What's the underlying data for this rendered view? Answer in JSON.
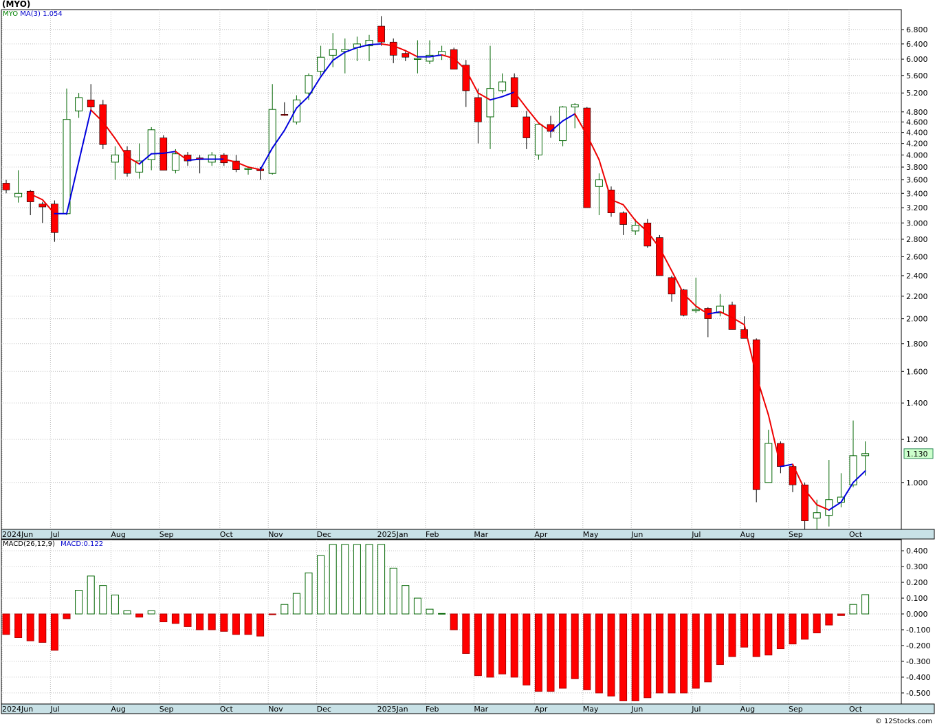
{
  "header": {
    "symbol_title": "(MYO)",
    "price_legend_symbol": "MYO",
    "price_legend_ma": "MA(3)",
    "price_legend_ma_value": "1.054",
    "macd_legend_name": "MACD(26,12,9)",
    "macd_legend_value": "MACD:0.122"
  },
  "footer": {
    "credit": "© 12Stocks.com"
  },
  "colors": {
    "up_candle": "#006400",
    "down_candle": "#ff0000",
    "ma_rising": "#0000dd",
    "ma_falling": "#ee0000",
    "macd_up": "#006400",
    "macd_down": "#ff0000",
    "last_price_box": "#ccffcc"
  },
  "chart_data": [
    {
      "type": "candlestick",
      "title": "(MYO)",
      "interval": "weekly",
      "yscale": "log",
      "ylim": [
        0.82,
        7.4
      ],
      "yticks": [
        1.0,
        1.2,
        1.4,
        1.6,
        1.8,
        2.0,
        2.2,
        2.4,
        2.6,
        2.8,
        3.0,
        3.2,
        3.4,
        3.6,
        3.8,
        4.0,
        4.2,
        4.4,
        4.6,
        4.8,
        5.2,
        5.6,
        6.0,
        6.4,
        6.8
      ],
      "ytick_labels": [
        "1.000",
        "1.200",
        "1.400",
        "1.600",
        "1.800",
        "2.000",
        "2.200",
        "2.400",
        "2.600",
        "2.800",
        "3.000",
        "3.200",
        "3.400",
        "3.600",
        "3.800",
        "4.000",
        "4.200",
        "4.400",
        "4.600",
        "4.800",
        "5.200",
        "5.600",
        "6.000",
        "6.400",
        "6.800"
      ],
      "x_labels": [
        {
          "label": "2024Jun",
          "week": 0
        },
        {
          "label": "Jul",
          "week": 4
        },
        {
          "label": "Aug",
          "week": 9
        },
        {
          "label": "Sep",
          "week": 13
        },
        {
          "label": "Oct",
          "week": 18
        },
        {
          "label": "Nov",
          "week": 22
        },
        {
          "label": "Dec",
          "week": 26
        },
        {
          "label": "2025Jan",
          "week": 31
        },
        {
          "label": "Feb",
          "week": 35
        },
        {
          "label": "Mar",
          "week": 39
        },
        {
          "label": "Apr",
          "week": 44
        },
        {
          "label": "May",
          "week": 48
        },
        {
          "label": "Jun",
          "week": 52
        },
        {
          "label": "Jul",
          "week": 57
        },
        {
          "label": "Aug",
          "week": 61
        },
        {
          "label": "Sep",
          "week": 65
        },
        {
          "label": "Oct",
          "week": 70
        }
      ],
      "last_price_label": "1.130",
      "ohlc": [
        [
          3.55,
          3.6,
          3.4,
          3.45
        ],
        [
          3.35,
          3.75,
          3.27,
          3.4
        ],
        [
          3.43,
          3.45,
          3.1,
          3.28
        ],
        [
          3.25,
          3.28,
          3.0,
          3.21
        ],
        [
          3.25,
          3.3,
          2.77,
          2.88
        ],
        [
          3.12,
          5.3,
          3.1,
          4.65
        ],
        [
          4.82,
          5.2,
          4.68,
          5.1
        ],
        [
          5.05,
          5.4,
          4.8,
          4.9
        ],
        [
          4.95,
          5.05,
          4.1,
          4.18
        ],
        [
          3.88,
          4.15,
          3.6,
          4.0
        ],
        [
          4.08,
          4.15,
          3.65,
          3.7
        ],
        [
          3.72,
          4.2,
          3.62,
          3.9
        ],
        [
          3.92,
          4.5,
          3.75,
          4.45
        ],
        [
          4.3,
          4.35,
          3.75,
          3.75
        ],
        [
          3.75,
          4.1,
          3.7,
          4.02
        ],
        [
          4.0,
          4.05,
          3.82,
          3.9
        ],
        [
          3.95,
          4.0,
          3.7,
          3.92
        ],
        [
          3.88,
          4.05,
          3.82,
          4.0
        ],
        [
          4.0,
          4.03,
          3.82,
          3.87
        ],
        [
          3.9,
          4.0,
          3.72,
          3.76
        ],
        [
          3.77,
          3.8,
          3.68,
          3.78
        ],
        [
          3.77,
          3.8,
          3.6,
          3.74
        ],
        [
          3.7,
          5.4,
          3.68,
          4.85
        ],
        [
          4.75,
          5.0,
          4.72,
          4.73
        ],
        [
          4.6,
          5.15,
          4.55,
          5.05
        ],
        [
          5.2,
          5.65,
          5.05,
          5.6
        ],
        [
          5.7,
          6.35,
          5.6,
          6.05
        ],
        [
          6.1,
          6.7,
          5.8,
          6.25
        ],
        [
          6.2,
          6.55,
          5.65,
          6.25
        ],
        [
          6.3,
          6.6,
          5.95,
          6.4
        ],
        [
          6.35,
          6.65,
          5.95,
          6.5
        ],
        [
          6.9,
          7.2,
          6.35,
          6.45
        ],
        [
          6.45,
          6.55,
          5.9,
          6.1
        ],
        [
          6.15,
          6.2,
          5.95,
          6.05
        ],
        [
          6.0,
          6.5,
          5.65,
          6.02
        ],
        [
          5.95,
          6.5,
          5.88,
          6.1
        ],
        [
          6.1,
          6.35,
          5.98,
          6.2
        ],
        [
          6.25,
          6.3,
          5.75,
          5.75
        ],
        [
          5.85,
          5.98,
          4.9,
          5.25
        ],
        [
          5.1,
          5.3,
          4.2,
          4.6
        ],
        [
          4.7,
          6.35,
          4.1,
          5.3
        ],
        [
          5.25,
          5.65,
          5.2,
          5.45
        ],
        [
          5.55,
          5.65,
          4.9,
          4.9
        ],
        [
          4.7,
          4.82,
          4.1,
          4.3
        ],
        [
          4.0,
          4.55,
          3.92,
          4.55
        ],
        [
          4.55,
          4.72,
          4.3,
          4.42
        ],
        [
          4.25,
          4.92,
          4.15,
          4.9
        ],
        [
          4.9,
          4.98,
          4.48,
          4.95
        ],
        [
          4.88,
          4.9,
          3.2,
          3.2
        ],
        [
          3.5,
          3.7,
          3.1,
          3.6
        ],
        [
          3.45,
          3.5,
          3.08,
          3.13
        ],
        [
          3.13,
          3.15,
          2.85,
          2.98
        ],
        [
          2.9,
          3.05,
          2.85,
          2.97
        ],
        [
          3.0,
          3.05,
          2.7,
          2.72
        ],
        [
          2.82,
          2.85,
          2.4,
          2.4
        ],
        [
          2.38,
          2.4,
          2.15,
          2.22
        ],
        [
          2.26,
          2.27,
          2.02,
          2.03
        ],
        [
          2.07,
          2.38,
          2.05,
          2.08
        ],
        [
          2.09,
          2.1,
          1.85,
          2.0
        ],
        [
          2.05,
          2.22,
          2.02,
          2.11
        ],
        [
          2.12,
          2.15,
          1.91,
          1.91
        ],
        [
          1.91,
          2.02,
          1.85,
          1.84
        ],
        [
          1.83,
          1.84,
          0.92,
          0.97
        ],
        [
          1.0,
          1.25,
          1.0,
          1.18
        ],
        [
          1.18,
          1.19,
          1.04,
          1.07
        ],
        [
          1.07,
          1.08,
          0.96,
          0.99
        ],
        [
          0.99,
          1.0,
          0.82,
          0.85
        ],
        [
          0.86,
          0.93,
          0.82,
          0.88
        ],
        [
          0.87,
          1.1,
          0.83,
          0.93
        ],
        [
          0.92,
          1.04,
          0.9,
          0.94
        ],
        [
          0.99,
          1.3,
          0.98,
          1.12
        ],
        [
          1.12,
          1.19,
          1.03,
          1.13
        ]
      ],
      "ma3": [
        null,
        null,
        3.39,
        3.31,
        3.12,
        3.12,
        3.89,
        4.84,
        4.6,
        4.29,
        3.97,
        3.85,
        4.02,
        4.03,
        4.06,
        3.91,
        3.93,
        3.93,
        3.93,
        3.88,
        3.8,
        3.76,
        4.12,
        4.44,
        4.88,
        5.13,
        5.57,
        5.97,
        6.18,
        6.3,
        6.38,
        6.4,
        6.35,
        6.22,
        6.06,
        6.06,
        6.11,
        6.02,
        5.73,
        5.2,
        5.05,
        5.12,
        5.22,
        4.88,
        4.58,
        4.42,
        4.62,
        4.76,
        4.35,
        3.92,
        3.31,
        3.24,
        3.03,
        2.89,
        2.7,
        2.45,
        2.22,
        2.11,
        2.04,
        2.06,
        2.01,
        1.95,
        1.57,
        1.33,
        1.07,
        1.08,
        0.97,
        0.91,
        0.89,
        0.92,
        1.0,
        1.05
      ]
    },
    {
      "type": "bar",
      "title": "MACD(26,12,9)",
      "ylim": [
        -0.57,
        0.47
      ],
      "yticks": [
        -0.5,
        -0.4,
        -0.3,
        -0.2,
        -0.1,
        0.0,
        0.1,
        0.2,
        0.3,
        0.4
      ],
      "ytick_labels": [
        "-0.500",
        "-0.400",
        "-0.300",
        "-0.200",
        "-0.100",
        "0.000",
        "0.100",
        "0.200",
        "0.300",
        "0.400"
      ],
      "values": [
        -0.13,
        -0.15,
        -0.17,
        -0.18,
        -0.23,
        -0.03,
        0.15,
        0.24,
        0.18,
        0.12,
        0.02,
        -0.02,
        0.02,
        -0.05,
        -0.06,
        -0.08,
        -0.1,
        -0.1,
        -0.11,
        -0.13,
        -0.13,
        -0.14,
        -0.005,
        0.06,
        0.13,
        0.26,
        0.37,
        0.44,
        0.44,
        0.44,
        0.44,
        0.44,
        0.29,
        0.18,
        0.1,
        0.03,
        0.003,
        -0.1,
        -0.25,
        -0.39,
        -0.4,
        -0.38,
        -0.4,
        -0.45,
        -0.49,
        -0.49,
        -0.47,
        -0.41,
        -0.48,
        -0.5,
        -0.52,
        -0.55,
        -0.55,
        -0.53,
        -0.5,
        -0.5,
        -0.5,
        -0.47,
        -0.43,
        -0.32,
        -0.27,
        -0.21,
        -0.27,
        -0.26,
        -0.22,
        -0.19,
        -0.16,
        -0.12,
        -0.07,
        -0.01,
        0.06,
        0.122
      ]
    }
  ]
}
